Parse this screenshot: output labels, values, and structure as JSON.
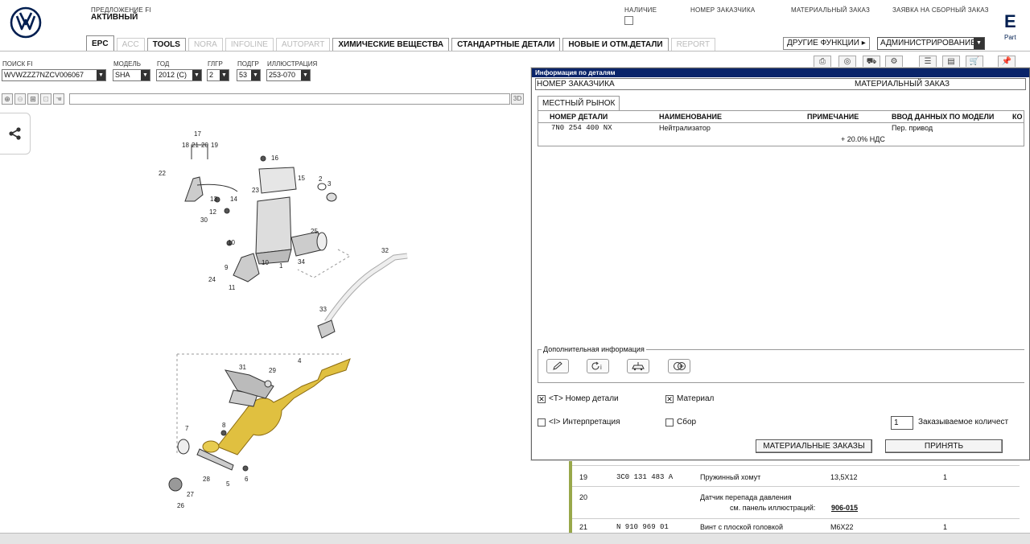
{
  "header": {
    "offer_label": "ПРЕДЛОЖЕНИЕ FI",
    "offer_value": "АКТИВНЫЙ",
    "availability_label": "НАЛИЧИЕ",
    "customer_number_label": "НОМЕР ЗАКАЗЧИКА",
    "material_order_label": "МАТЕРИАЛЬНЫЙ ЗАКАЗ",
    "assembly_order_label": "ЗАЯВКА НА СБОРНЫЙ ЗАКАЗ",
    "brand_partial": "E",
    "brand_partial_sub": "Part"
  },
  "tabs": [
    {
      "label": "EPC"
    },
    {
      "label": "ACC"
    },
    {
      "label": "TOOLS"
    },
    {
      "label": "NORA"
    },
    {
      "label": "INFOLINE"
    },
    {
      "label": "AUTOPART"
    },
    {
      "label": "ХИМИЧЕСКИЕ ВЕЩЕСТВА"
    },
    {
      "label": "СТАНДАРТНЫЕ ДЕТАЛИ"
    },
    {
      "label": "НОВЫЕ И ОТМ.ДЕТАЛИ"
    },
    {
      "label": "REPORT"
    }
  ],
  "functions": {
    "other_label": "ДРУГИЕ ФУНКЦИИ",
    "admin_value": "АДМИНИСТРИРОВАНИЕ"
  },
  "filters": {
    "search_label": "ПОИСК FI",
    "search_value": "WVWZZZ7NZCV006067",
    "model_label": "МОДЕЛЬ",
    "model_value": "SHA",
    "year_label": "ГОД",
    "year_value": "2012 (C)",
    "mg_label": "ГЛГР",
    "mg_value": "2",
    "sg_label": "ПОДГР",
    "sg_value": "53",
    "illus_label": "ИЛЛЮСТРАЦИЯ",
    "illus_value": "253-070"
  },
  "zoom": {
    "btn_3d": "3D"
  },
  "illustration": {
    "callouts": [
      "17",
      "18",
      "21",
      "20",
      "19",
      "16",
      "15",
      "22",
      "23",
      "2",
      "3",
      "13",
      "14",
      "12",
      "30",
      "25",
      "10",
      "10",
      "1",
      "34",
      "9",
      "24",
      "11",
      "32",
      "33",
      "4",
      "31",
      "29",
      "7",
      "8",
      "5",
      "6",
      "28",
      "27",
      "26"
    ]
  },
  "dialog": {
    "title": "Информация по деталям",
    "customer_number": "НОМЕР ЗАКАЗЧИКА",
    "material_order": "МАТЕРИАЛЬНЫЙ ЗАКАЗ",
    "market_tab": "МЕСТНЫЙ РЫНОК",
    "columns": [
      "НОМЕР ДЕТАЛИ",
      "НАИМЕНОВАНИЕ",
      "ПРИМЕЧАНИЕ",
      "ВВОД ДАННЫХ ПО МОДЕЛИ",
      "КО"
    ],
    "row": {
      "part_number": "7N0 254 400 NX",
      "name": "Нейтрализатор",
      "note": "+ 20.0% НДС",
      "model_data": "Пер. привод"
    },
    "additional_info_title": "Дополнительная информация",
    "opt_part_number": "<T> Номер детали",
    "opt_material": "Материал",
    "opt_interpretation": "<I> Интерпретация",
    "opt_assembly": "Сбор",
    "qty_value": "1",
    "qty_label": "Заказываемое количест",
    "btn_material_orders": "МАТЕРИАЛЬНЫЕ ЗАКАЗЫ",
    "btn_accept": "ПРИНЯТЬ"
  },
  "parts_rows": [
    {
      "pos": "19",
      "part": "3C0 131 483 A",
      "name": "Пружинный хомут",
      "spec": "13,5X12",
      "qty": "1"
    },
    {
      "pos": "20",
      "part": "",
      "name": "Датчик перепада давления",
      "sub_label": "см. панель иллюстраций:",
      "sub_link": "906-015",
      "spec": "",
      "qty": ""
    },
    {
      "pos": "21",
      "part": "N   910 969 01",
      "name": "Винт с плоской головкой",
      "spec": "M6X22",
      "qty": "1"
    }
  ],
  "colors": {
    "title_bar": "#0a246a",
    "accent_green": "#98a84a",
    "highlight_part": "#e0c040"
  }
}
